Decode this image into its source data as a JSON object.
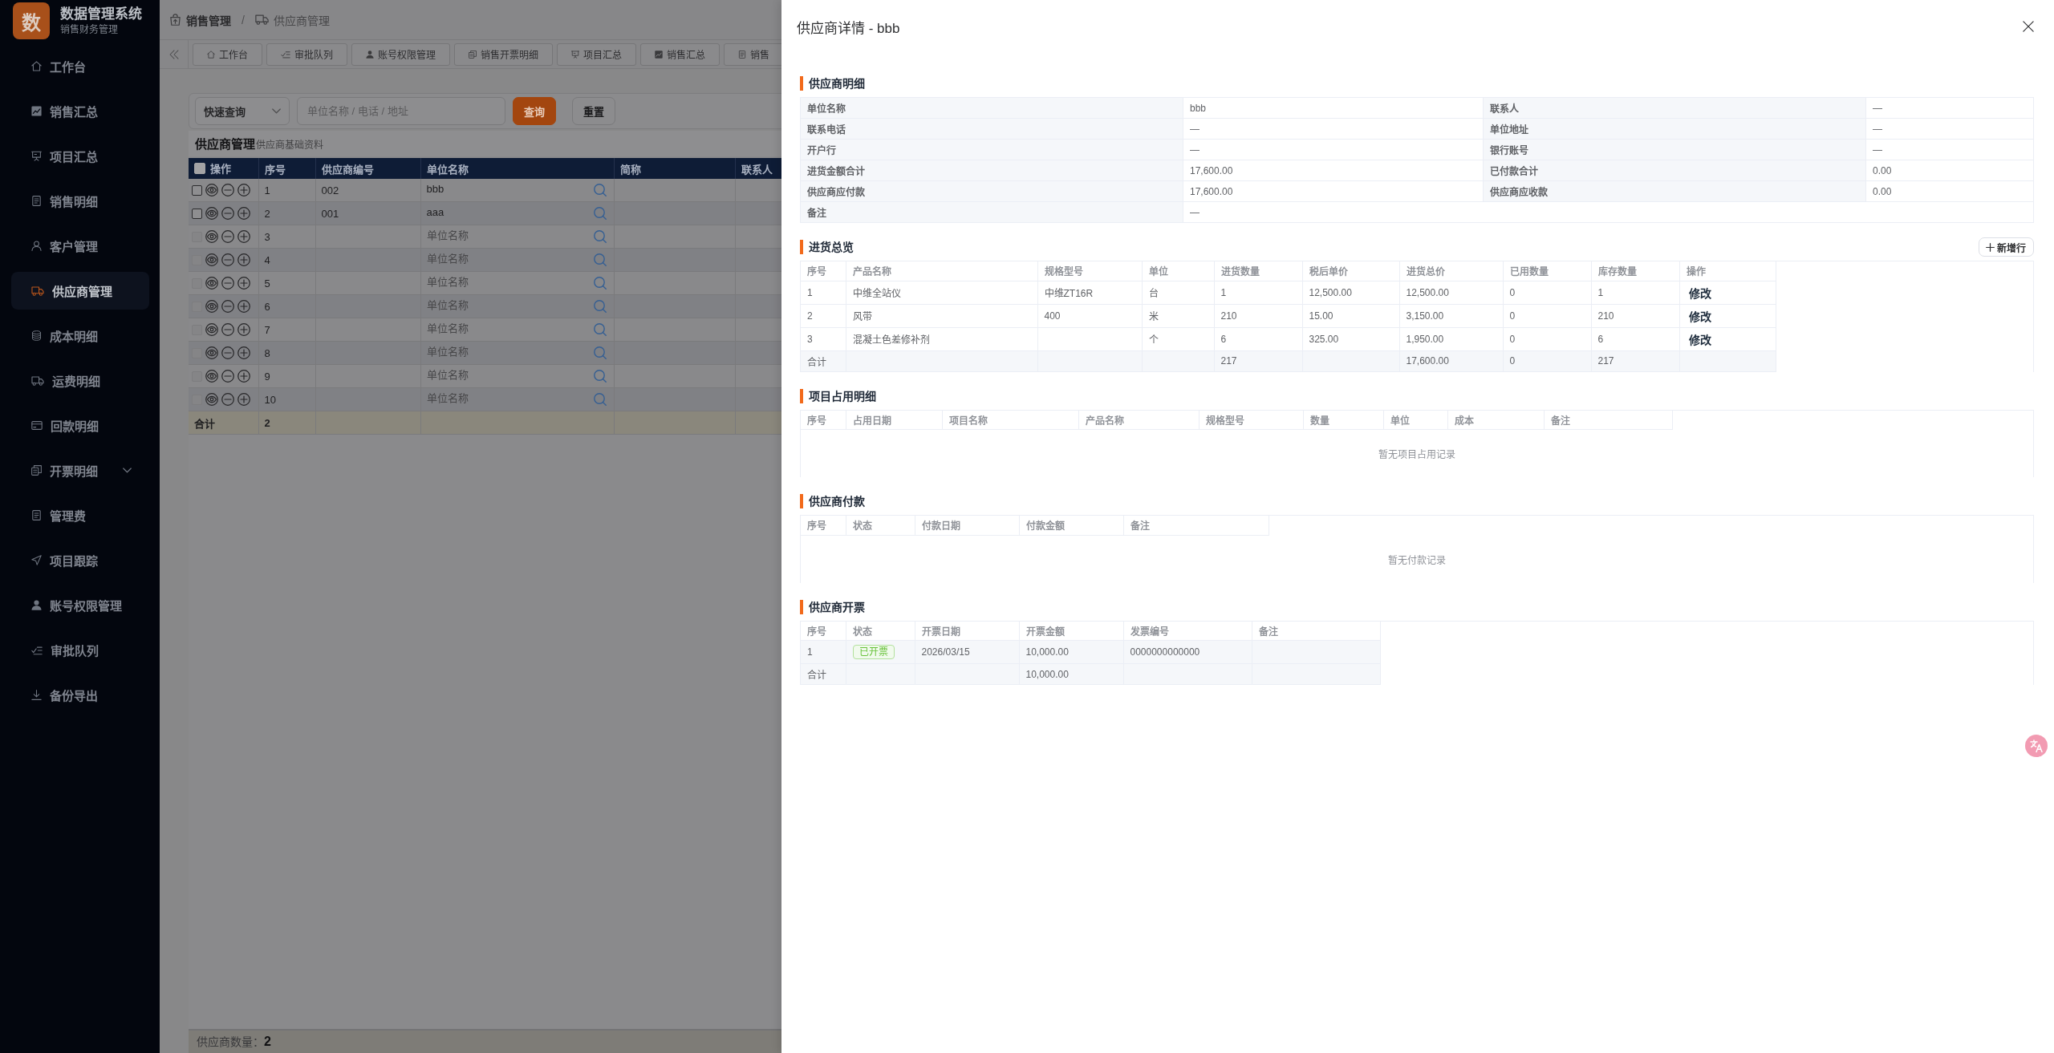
{
  "sidebar": {
    "logo": {
      "mark": "数",
      "title": "数据管理系统",
      "subtitle": "销售财务管理"
    },
    "items": [
      {
        "label": "工作台",
        "kind": "link",
        "selected": false
      },
      {
        "label": "销售汇总",
        "kind": "link",
        "selected": false
      },
      {
        "label": "项目汇总",
        "kind": "link",
        "selected": false
      },
      {
        "label": "销售明细",
        "kind": "link",
        "selected": false
      },
      {
        "label": "客户管理",
        "kind": "link",
        "selected": false
      },
      {
        "label": "供应商管理",
        "kind": "link",
        "selected": true
      },
      {
        "label": "成本明细",
        "kind": "link",
        "selected": false
      },
      {
        "label": "运费明细",
        "kind": "link",
        "selected": false
      },
      {
        "label": "回款明细",
        "kind": "link",
        "selected": false
      },
      {
        "label": "开票明细",
        "kind": "group",
        "selected": false,
        "expanded": false
      },
      {
        "label": "管理费",
        "kind": "link",
        "selected": false
      },
      {
        "label": "项目跟踪",
        "kind": "link",
        "selected": false
      },
      {
        "label": "账号权限管理",
        "kind": "link",
        "selected": false
      },
      {
        "label": "审批队列",
        "kind": "link",
        "selected": false
      },
      {
        "label": "备份导出",
        "kind": "link",
        "selected": false
      }
    ]
  },
  "breadcrumb": {
    "items": [
      "销售管理",
      "供应商管理"
    ],
    "separator": "/"
  },
  "tabs": [
    {
      "label": "工作台",
      "selected": false
    },
    {
      "label": "审批队列",
      "selected": false
    },
    {
      "label": "账号权限管理",
      "selected": false
    },
    {
      "label": "销售开票明细",
      "selected": false
    },
    {
      "label": "项目汇总",
      "selected": false
    },
    {
      "label": "销售汇总",
      "selected": false
    },
    {
      "label": "销售",
      "selected": false
    }
  ],
  "search": {
    "filter": "快速查询",
    "placeholder": "单位名称 / 电话 / 地址",
    "buttons": [
      {
        "label": "查询",
        "kind": "primary"
      },
      {
        "label": "重置",
        "kind": "default"
      }
    ]
  },
  "supplier_list": {
    "title": "供应商管理",
    "subtitle": "供应商基础资料",
    "select_all_checked": false,
    "columns": [
      "操作",
      "序号",
      "供应商编号",
      "单位名称",
      "简称",
      "联系人"
    ],
    "rows": [
      {
        "index": "1",
        "code": "002",
        "name": "bbb",
        "checked": false,
        "disabled": false
      },
      {
        "index": "2",
        "code": "001",
        "name": "aaa",
        "checked": false,
        "disabled": false
      },
      {
        "index": "3",
        "name_placeholder": "单位名称",
        "checked": false,
        "disabled": true
      },
      {
        "index": "4",
        "name_placeholder": "单位名称",
        "checked": false,
        "disabled": true
      },
      {
        "index": "5",
        "name_placeholder": "单位名称",
        "checked": false,
        "disabled": true
      },
      {
        "index": "6",
        "name_placeholder": "单位名称",
        "checked": false,
        "disabled": true
      },
      {
        "index": "7",
        "name_placeholder": "单位名称",
        "checked": false,
        "disabled": true
      },
      {
        "index": "8",
        "name_placeholder": "单位名称",
        "checked": false,
        "disabled": true
      },
      {
        "index": "9",
        "name_placeholder": "单位名称",
        "checked": false,
        "disabled": true
      },
      {
        "index": "10",
        "name_placeholder": "单位名称",
        "checked": false,
        "disabled": true
      }
    ],
    "total": {
      "label": "合计",
      "count": "2"
    }
  },
  "footer": {
    "text": "供应商数量：**2**"
  },
  "drawer": {
    "title": "供应商详情 - bbb",
    "sections": [
      {
        "kind": "details",
        "heading": "供应商明细",
        "fields": [
          {
            "label": "单位名称",
            "value": "bbb"
          },
          {
            "label": "联系人",
            "value": "—"
          },
          {
            "label": "联系电话",
            "value": "—"
          },
          {
            "label": "单位地址",
            "value": "—"
          },
          {
            "label": "开户行",
            "value": "—"
          },
          {
            "label": "银行账号",
            "value": "—"
          },
          {
            "label": "进货金额合计",
            "value": "17,600.00"
          },
          {
            "label": "已付款合计",
            "value": "0.00"
          },
          {
            "label": "供应商应付款",
            "value": "17,600.00"
          },
          {
            "label": "供应商应收款",
            "value": "0.00"
          },
          {
            "label": "备注",
            "value": "—"
          }
        ]
      },
      {
        "kind": "table",
        "heading": "进货总览",
        "action": "新增行",
        "columns": [
          "序号",
          "产品名称",
          "规格型号",
          "单位",
          "进货数量",
          "税后单价",
          "进货总价",
          "已用数量",
          "库存数量",
          "操作"
        ],
        "rows": [
          {
            "index": "1",
            "product": "中维全站仪",
            "model": "中维ZT16R",
            "unit": "台",
            "quantity": "1",
            "unit_price": "12,500.00",
            "amount": "12,500.00",
            "used": "0",
            "stock": "1",
            "action": {
              "kind": "link",
              "text": "修改"
            }
          },
          {
            "index": "2",
            "product": "风带",
            "model": "400",
            "unit": "米",
            "quantity": "210",
            "unit_price": "15.00",
            "amount": "3,150.00",
            "used": "0",
            "stock": "210",
            "action": {
              "kind": "link",
              "text": "修改"
            }
          },
          {
            "index": "3",
            "product": "混凝土色差修补剂",
            "unit": "个",
            "quantity": "6",
            "unit_price": "325.00",
            "amount": "1,950.00",
            "used": "0",
            "stock": "6",
            "action": {
              "kind": "link",
              "text": "修改"
            }
          }
        ],
        "total": {
          "index": "合计",
          "quantity": "217",
          "amount": "17,600.00",
          "used": "0",
          "stock": "217"
        }
      },
      {
        "kind": "table",
        "heading": "项目占用明细",
        "columns": [
          "序号",
          "占用日期",
          "项目名称",
          "产品名称",
          "规格型号",
          "数量",
          "单位",
          "成本",
          "备注"
        ],
        "empty_text": "暂无项目占用记录"
      },
      {
        "kind": "table",
        "heading": "供应商付款",
        "columns": [
          "序号",
          "状态",
          "付款日期",
          "付款金额",
          "备注"
        ],
        "empty_text": "暂无付款记录"
      },
      {
        "kind": "table",
        "heading": "供应商开票",
        "columns": [
          "序号",
          "状态",
          "开票日期",
          "开票金额",
          "发票编号",
          "备注"
        ],
        "rows": [
          {
            "index": "1",
            "status": {
              "kind": "tag",
              "text": "已开票",
              "color": "#67c23a"
            },
            "date": "2026/03/15",
            "amount": "10,000.00",
            "invoice_no": "0000000000000"
          }
        ],
        "total": {
          "index": "合计",
          "amount": "10,000.00"
        }
      }
    ]
  }
}
